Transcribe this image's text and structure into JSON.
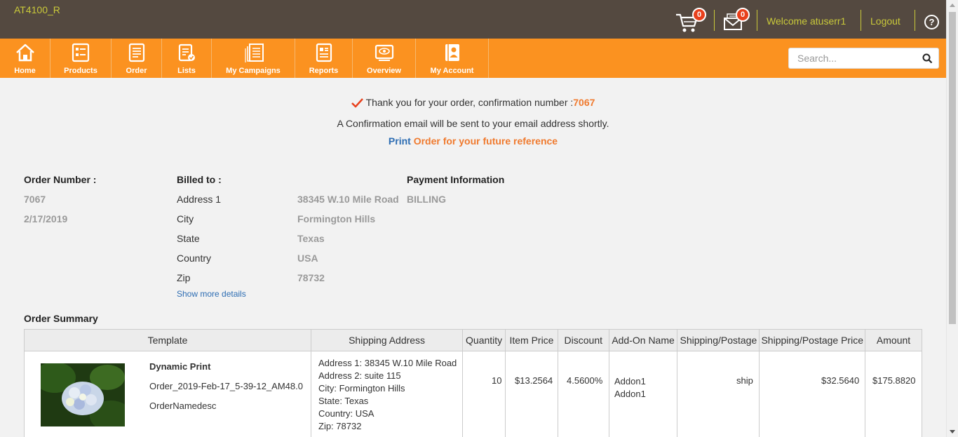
{
  "header": {
    "brand": "AT4100_R",
    "cart_count": "0",
    "message_count": "0",
    "welcome": "Welcome atuserr1",
    "logout": "Logout",
    "help": "?"
  },
  "nav": {
    "items": [
      {
        "label": "Home",
        "icon": "home-icon"
      },
      {
        "label": "Products",
        "icon": "products-icon"
      },
      {
        "label": "Order",
        "icon": "order-icon"
      },
      {
        "label": "Lists",
        "icon": "lists-icon"
      },
      {
        "label": "My Campaigns",
        "icon": "campaigns-icon"
      },
      {
        "label": "Reports",
        "icon": "reports-icon"
      },
      {
        "label": "Overview",
        "icon": "overview-icon"
      },
      {
        "label": "My Account",
        "icon": "account-icon"
      }
    ],
    "search_placeholder": "Search..."
  },
  "confirmation": {
    "thank_you": "Thank you for your order, confirmation number :",
    "number": "7067",
    "email_notice": "A Confirmation email will be sent to your email address shortly.",
    "print_link": "Print",
    "print_rest": "Order for your future reference"
  },
  "order": {
    "number_label": "Order Number :",
    "number": "7067",
    "date": "2/17/2019"
  },
  "billing": {
    "label": "Billed to :",
    "fields": [
      {
        "label": "Address 1",
        "value": "38345 W.10 Mile Road"
      },
      {
        "label": "City",
        "value": "Formington Hills"
      },
      {
        "label": "State",
        "value": "Texas"
      },
      {
        "label": "Country",
        "value": "USA"
      },
      {
        "label": "Zip",
        "value": "78732"
      }
    ],
    "more_details": "Show more details"
  },
  "payment": {
    "label": "Payment Information",
    "method": "BILLING"
  },
  "summary": {
    "title": "Order Summary",
    "columns": [
      "Template",
      "Shipping Address",
      "Quantity",
      "Item Price",
      "Discount",
      "Add-On Name",
      "Shipping/Postage",
      "Shipping/Postage Price",
      "Amount"
    ],
    "row": {
      "template_name": "Dynamic Print",
      "order_name": "Order_2019-Feb-17_5-39-12_AM48.0",
      "description": "OrderNamedesc",
      "shipping_lines": [
        "Address 1: 38345 W.10 Mile Road",
        "Address 2: suite 115",
        "City: Formington Hills",
        "State: Texas",
        "Country: USA",
        "Zip: 78732"
      ],
      "quantity": "10",
      "item_price": "$13.2564",
      "discount": "4.5600%",
      "addons": [
        "Addon1",
        "Addon1"
      ],
      "shipping_method": "ship",
      "shipping_price": "$32.5640",
      "amount": "$175.8820"
    }
  },
  "colors": {
    "header_bg": "#544940",
    "nav_bg": "#fb9220",
    "accent": "#f07a2e",
    "link": "#2d6db3"
  }
}
